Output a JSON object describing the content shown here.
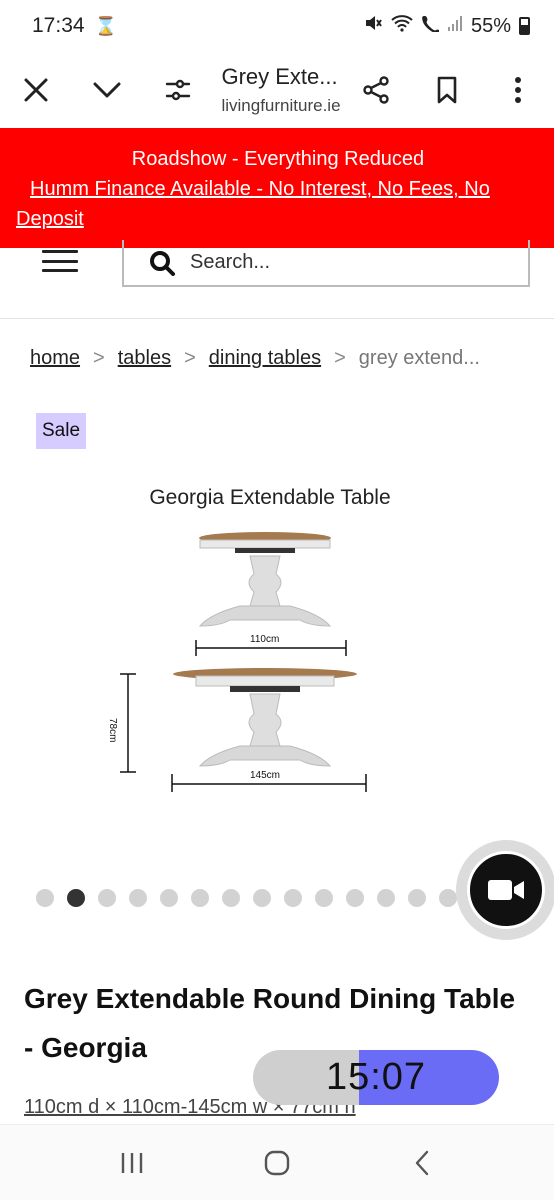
{
  "status_bar": {
    "time": "17:34",
    "battery": "55%",
    "hourglass_icon": "hourglass-icon",
    "status_icons": [
      "mute-icon",
      "wifi-icon",
      "wifi-calling-icon",
      "signal-icon"
    ]
  },
  "browser": {
    "title": "Grey Exte...",
    "domain": "livingfurniture.ie",
    "icons": [
      "close-icon",
      "chevron-down-icon",
      "page-settings-icon",
      "share-icon",
      "bookmark-icon",
      "more-icon"
    ]
  },
  "promo": {
    "line1": "Roadshow - Everything Reduced",
    "line2": "Humm Finance Available - No Interest, No Fees, No Deposit",
    "background": "#ff0000"
  },
  "search": {
    "placeholder": "Search..."
  },
  "breadcrumb": {
    "home": "home",
    "tables": "tables",
    "dining_tables": "dining tables",
    "current": "grey extend...",
    "separator": ">"
  },
  "badge": {
    "label": "Sale",
    "color": "#d6ccff"
  },
  "product_image": {
    "title": "Georgia Extendable Table",
    "dim_closed": "110cm",
    "dim_open": "145cm",
    "dim_height": "78cm"
  },
  "carousel": {
    "total_dots": 14,
    "active_index": 1
  },
  "product": {
    "title": "Grey Extendable Round Dining Table - Georgia",
    "dimensions": "110cm d × 110cm-145cm w × 77cm h"
  },
  "timer": {
    "text": "15:07",
    "accent": "#6a6cf6"
  },
  "nav": {
    "icons": [
      "recent-apps-icon",
      "home-icon",
      "back-icon"
    ]
  }
}
